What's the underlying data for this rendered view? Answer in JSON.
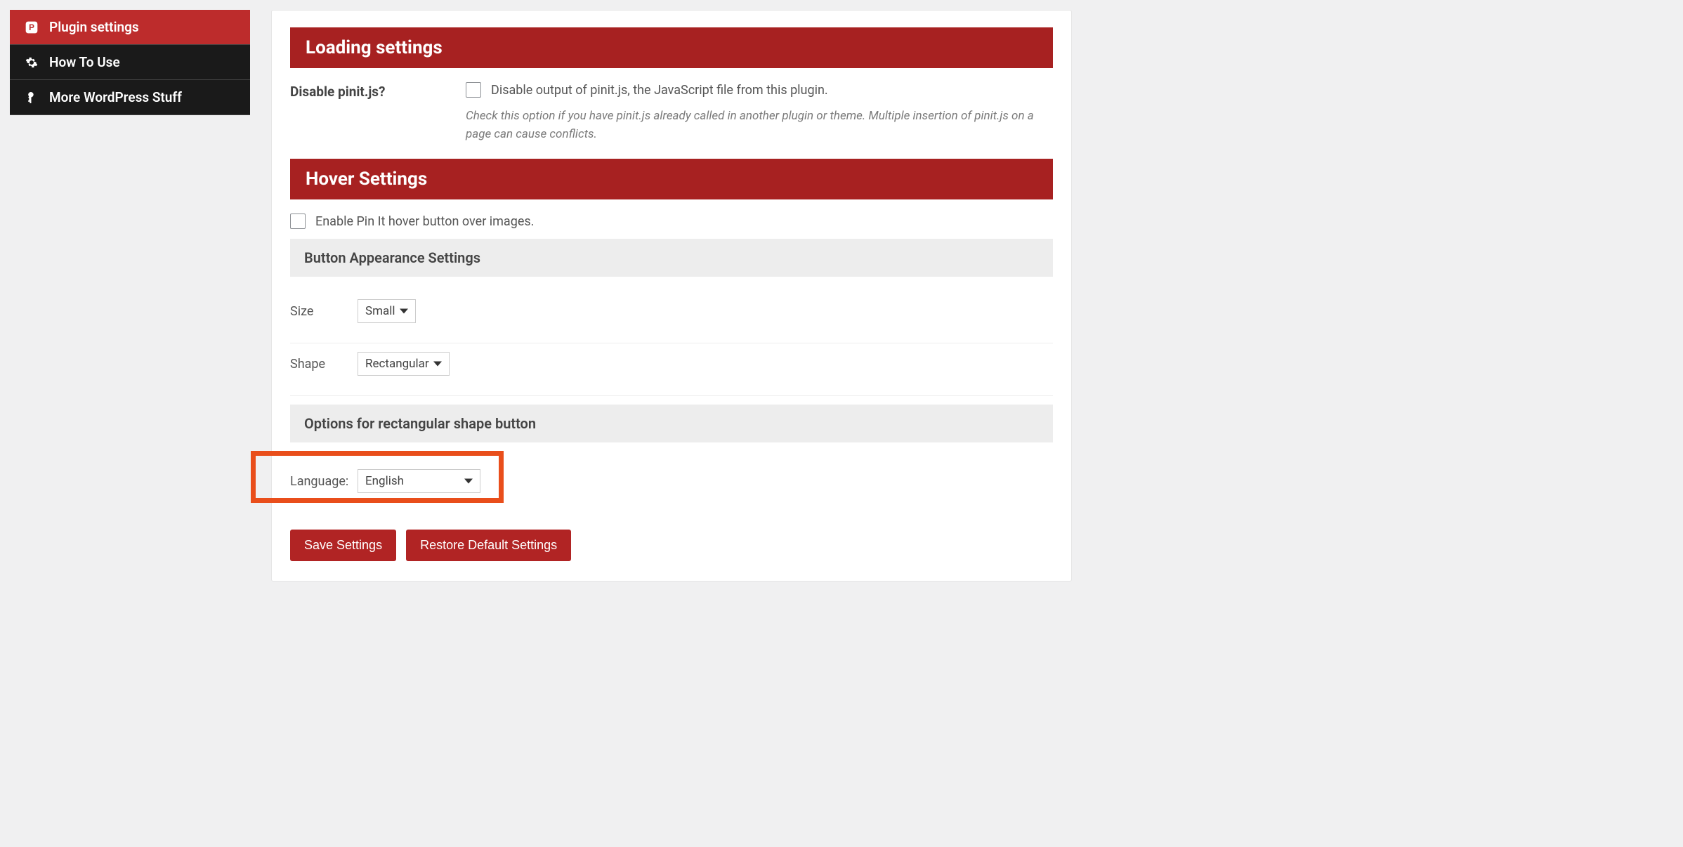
{
  "sidebar": {
    "items": [
      {
        "label": "Plugin settings",
        "icon": "pinterest-icon"
      },
      {
        "label": "How To Use",
        "icon": "gear-icon"
      },
      {
        "label": "More WordPress Stuff",
        "icon": "key-icon"
      }
    ]
  },
  "sections": {
    "loading": {
      "header": "Loading settings",
      "disable_label": "Disable pinit.js?",
      "disable_checkbox_text": "Disable output of pinit.js, the JavaScript file from this plugin.",
      "help_text": "Check this option if you have pinit.js already called in another plugin or theme. Multiple insertion of pinit.js on a page can cause conflicts."
    },
    "hover": {
      "header": "Hover Settings",
      "enable_text": "Enable Pin It hover button over images.",
      "appearance_header": "Button Appearance Settings",
      "size_label": "Size",
      "size_value": "Small",
      "shape_label": "Shape",
      "shape_value": "Rectangular",
      "rect_options_header": "Options for rectangular shape button",
      "language_label": "Language:",
      "language_value": "English"
    }
  },
  "buttons": {
    "save": "Save Settings",
    "restore": "Restore Default Settings"
  }
}
